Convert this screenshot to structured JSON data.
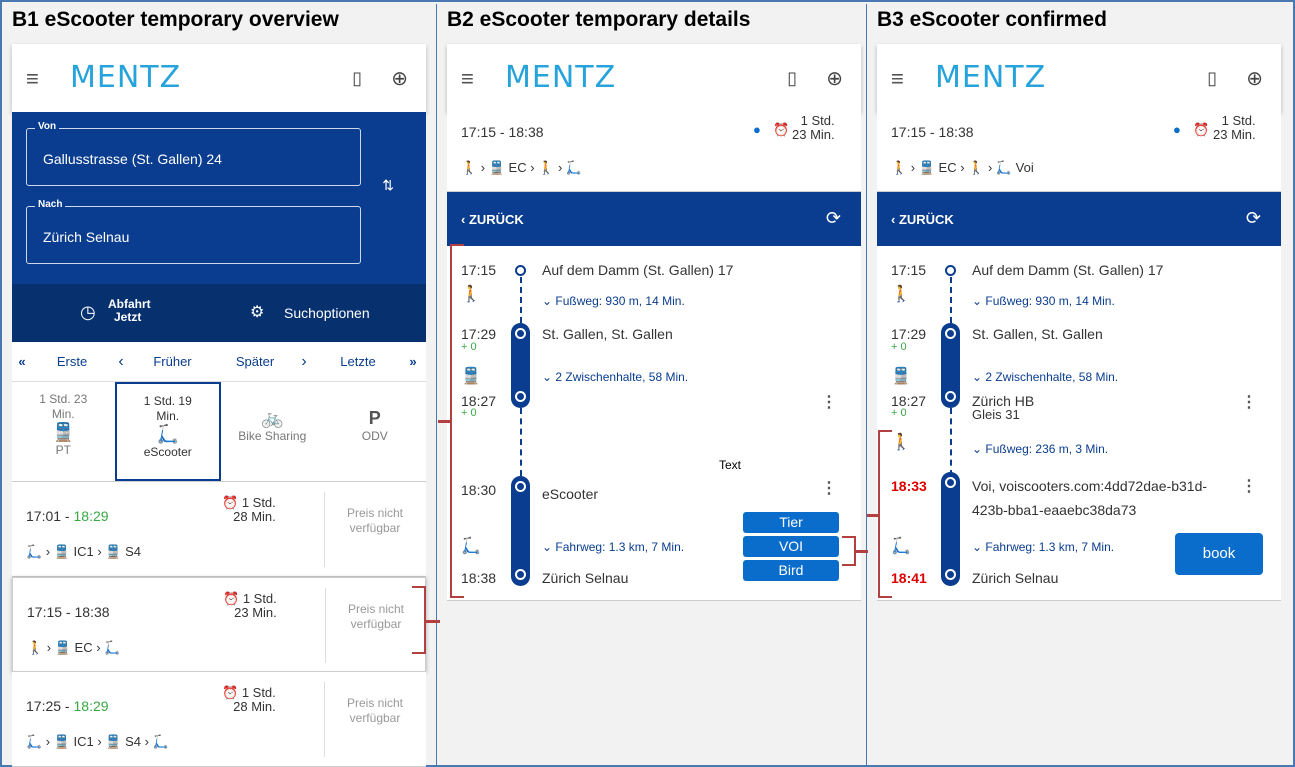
{
  "panels": {
    "b1_title": "B1 eScooter temporary overview",
    "b2_title": "B2 eScooter temporary details",
    "b3_title": "B3 eScooter confirmed"
  },
  "app": {
    "logo": "MENTZ",
    "menu_icon": "hamburger-icon",
    "map_icon": "map-icon",
    "globe_icon": "globe-icon"
  },
  "search": {
    "from_label": "Von",
    "from_value": "Gallusstrasse (St. Gallen) 24",
    "to_label": "Nach",
    "to_value": "Zürich Selnau"
  },
  "options": {
    "departure_line1": "Abfahrt",
    "departure_line2": "Jetzt",
    "search_options": "Suchoptionen"
  },
  "nav": {
    "first": "Erste",
    "earlier": "Früher",
    "later": "Später",
    "last": "Letzte"
  },
  "modes": [
    {
      "dur1": "1 Std. 23",
      "dur2": "Min.",
      "icon": "train-icon",
      "label": "PT"
    },
    {
      "dur1": "1 Std. 19",
      "dur2": "Min.",
      "icon": "escooter-icon",
      "label": "eScooter"
    },
    {
      "dur1": "",
      "dur2": "",
      "icon": "bike-icon",
      "label": "Bike Sharing"
    },
    {
      "dur1": "",
      "dur2": "",
      "icon": "parking-icon",
      "label": "ODV"
    }
  ],
  "trips": [
    {
      "dep": "17:01",
      "sep": " - ",
      "arr": "18:29",
      "dur1": "1 Std.",
      "dur2": "28 Min.",
      "price": "Preis nicht verfügbar",
      "legs": "🛴 › 🚆 IC1 › 🚆 S4"
    },
    {
      "dep": "17:15",
      "sep": " - ",
      "arr": "18:38",
      "dur1": "1 Std.",
      "dur2": "23 Min.",
      "price": "Preis nicht verfügbar",
      "legs": "🚶 › 🚆 EC › 🛴"
    },
    {
      "dep": "17:25",
      "sep": " - ",
      "arr": "18:29",
      "dur1": "1 Std.",
      "dur2": "28 Min.",
      "price": "Preis nicht verfügbar",
      "legs": "🛴 › 🚆 IC1 › 🚆 S4 › 🛴"
    }
  ],
  "detail_header": {
    "time": "17:15 - 18:38",
    "dur1": "1 Std.",
    "dur2": "23 Min.",
    "legs_b2": "🚶 › 🚆 EC › 🚶 › 🛴",
    "legs_b3": "🚶 › 🚆 EC › 🚶 › 🛴 Voi"
  },
  "back": {
    "label": "‹ ZURÜCK",
    "refresh_icon": "refresh-icon"
  },
  "detail": {
    "t1": "17:15",
    "s1": "Auf dem Damm (St. Gallen) 17",
    "walk1": "⌄ Fußweg: 930 m, 14 Min.",
    "t2": "17:29",
    "plus2": "+ 0",
    "s2": "St. Gallen, St. Gallen",
    "stops": "⌄ 2 Zwischenhalte, 58 Min.",
    "t3": "18:27",
    "plus3": "+ 0",
    "s3_b3": "Zürich HB",
    "s3_track": "Gleis 31",
    "walk2": "⌄ Fußweg: 236 m, 3 Min.",
    "text_label": "Text",
    "t4_b2": "18:30",
    "s4_b2": "eScooter",
    "t4_b3": "18:33",
    "s4_b3": "Voi, voiscooters.com:4dd72dae-b31d-",
    "s4_b3b": "423b-bba1-eaaebc38da73",
    "ride": "⌄ Fahrweg: 1.3 km, 7 Min.",
    "t5_b2": "18:38",
    "t5_b3": "18:41",
    "s5": "Zürich Selnau"
  },
  "providers": [
    "Tier",
    "VOI",
    "Bird"
  ],
  "book_label": "book",
  "colors": {
    "primary": "#0a3d8f",
    "accent": "#27a3dc",
    "button": "#0a6dcc",
    "delay_ok": "#3aa845",
    "highlight": "#b34040"
  }
}
